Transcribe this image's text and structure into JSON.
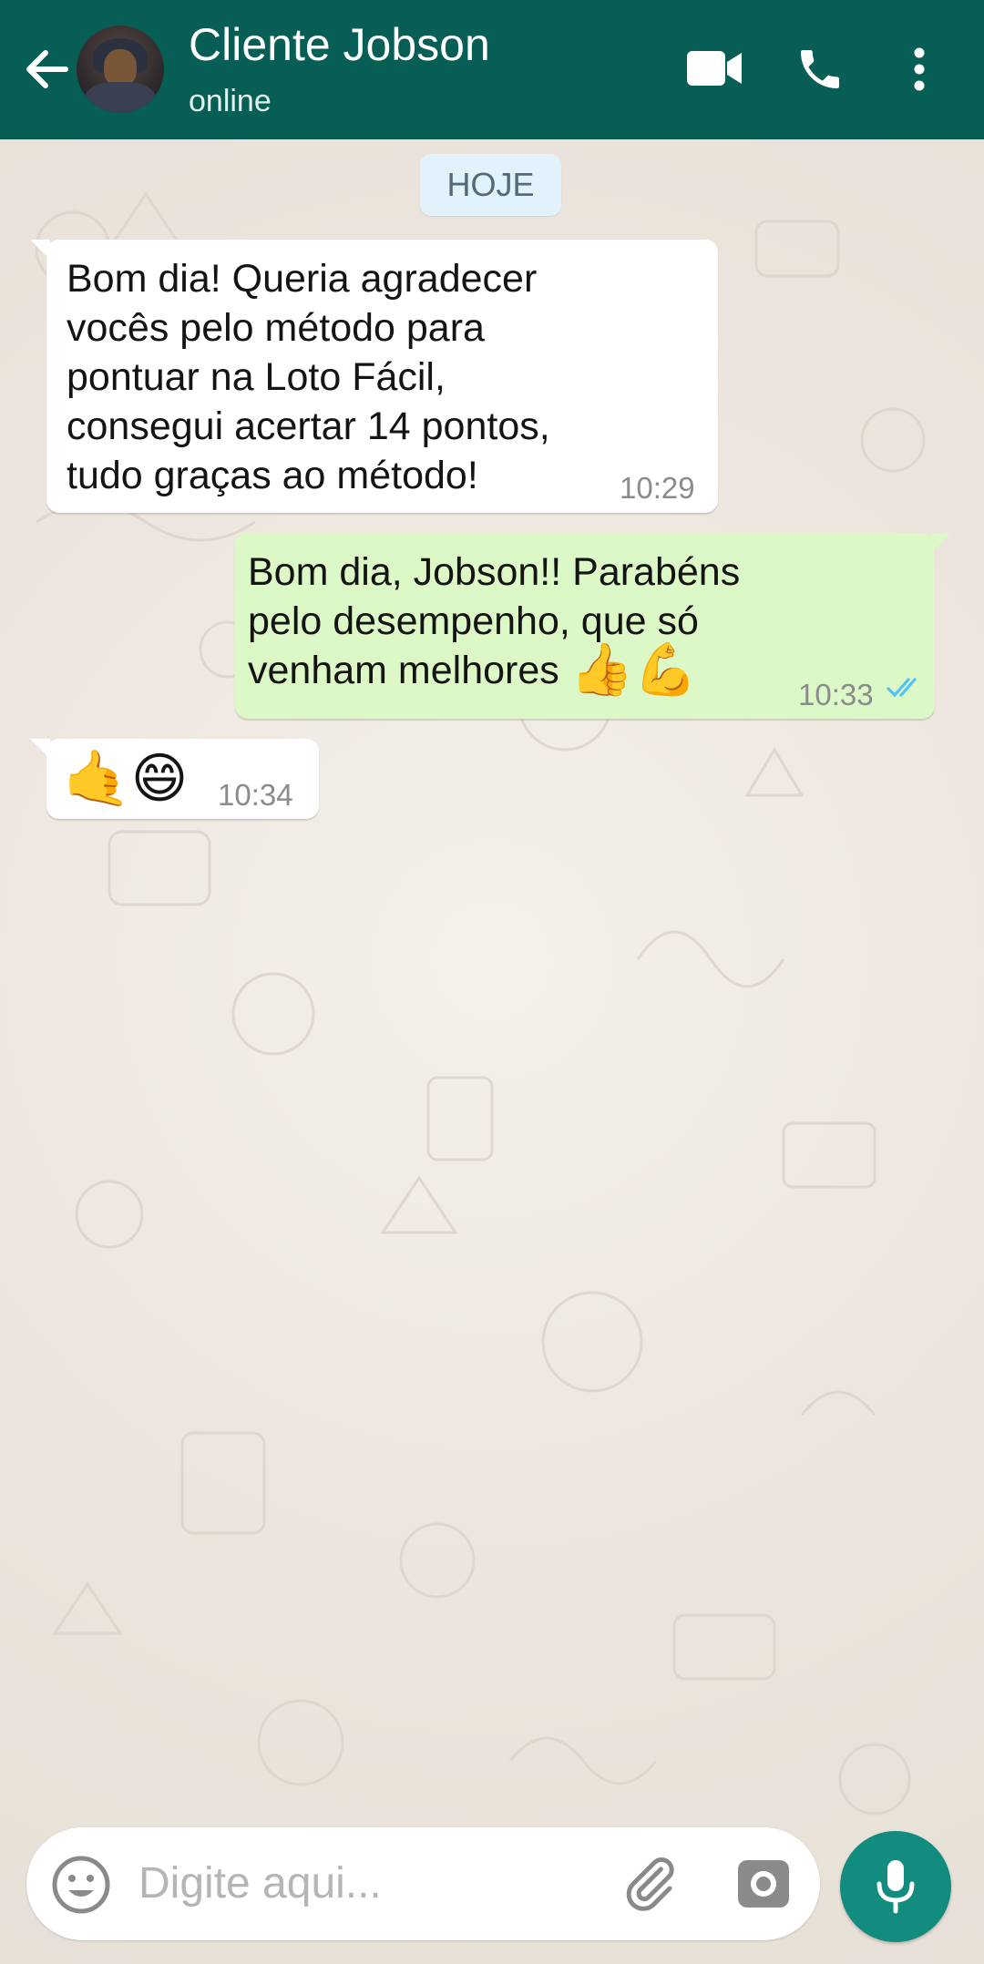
{
  "header": {
    "contact_name": "Cliente Jobson",
    "status": "online",
    "icons": [
      "back-arrow-icon",
      "video-call-icon",
      "phone-icon",
      "more-vert-icon"
    ],
    "colors": {
      "bar": "#075e54"
    }
  },
  "chat": {
    "date_label": "HOJE",
    "messages": [
      {
        "direction": "incoming",
        "text": "Bom dia! Queria agradecer\nvocês pelo método para\npontuar na Loto Fácil,\nconsegui acertar 14 pontos,\ntudo graças ao método!",
        "time": "10:29"
      },
      {
        "direction": "outgoing",
        "text": "Bom dia, Jobson!! Parabéns\npelo desempenho, que só\nvenham melhores",
        "emojis": "👍💪",
        "time": "10:33",
        "status_icon": "double-check-read-icon"
      },
      {
        "direction": "incoming",
        "emojis": "🤙😄",
        "time": "10:34"
      }
    ]
  },
  "composer": {
    "placeholder": "Digite aqui...",
    "icons": [
      "emoji-icon",
      "attach-icon",
      "camera-icon",
      "mic-icon"
    ],
    "colors": {
      "mic_button": "#128c7e"
    }
  }
}
